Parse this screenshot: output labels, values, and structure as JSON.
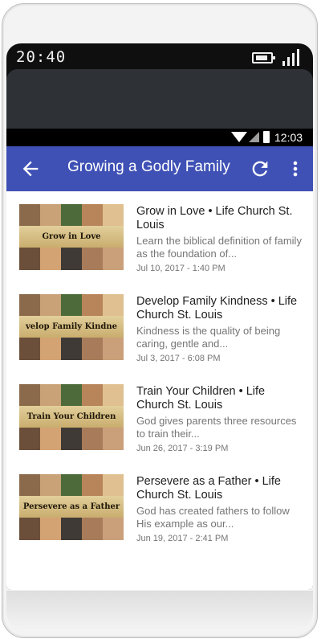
{
  "device": {
    "outer_time": "20:40",
    "inner_time": "12:03"
  },
  "toolbar": {
    "title": "Growing a Godly Family",
    "color": "#3f51b5"
  },
  "episodes": [
    {
      "thumb_text": "Grow in Love",
      "title": "Grow in Love • Life Church St. Louis",
      "description": "Learn the biblical definition of family as the foundation of...",
      "date": "Jul 10, 2017 - 1:40 PM"
    },
    {
      "thumb_text": "velop Family Kindne",
      "title": "Develop Family Kindness • Life Church St. Louis",
      "description": "Kindness is the quality of being caring, gentle and...",
      "date": "Jul 3, 2017 - 6:08 PM"
    },
    {
      "thumb_text": "Train Your Children",
      "title": "Train Your Children • Life Church St. Louis",
      "description": "God gives parents three resources to train their...",
      "date": "Jun 26, 2017 - 3:19 PM"
    },
    {
      "thumb_text": "Persevere as a Father",
      "title": "Persevere as a Father • Life Church St. Louis",
      "description": "God has created fathers to follow His example as our...",
      "date": "Jun 19, 2017 - 2:41 PM"
    }
  ]
}
